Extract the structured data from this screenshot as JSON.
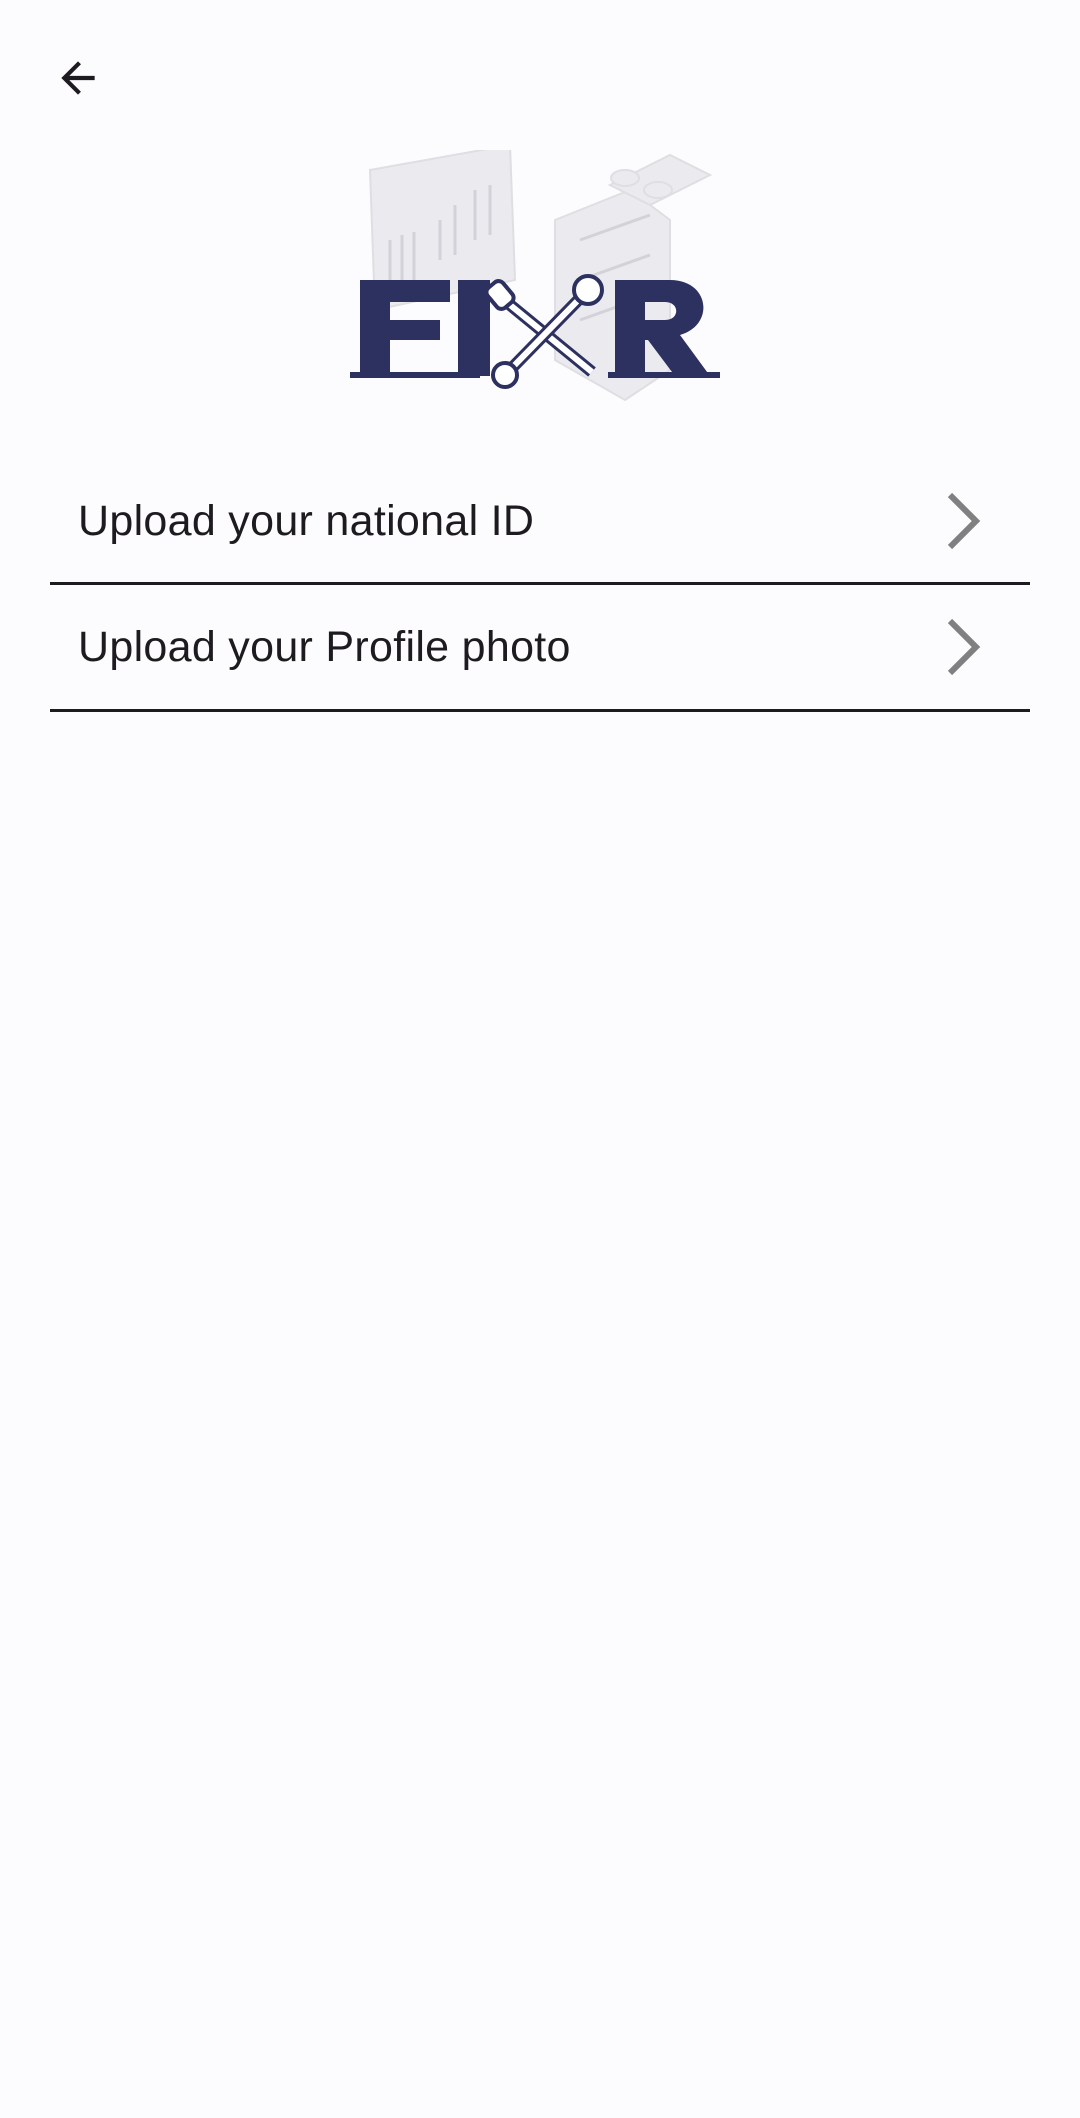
{
  "header": {
    "back_icon": "arrow-left-icon"
  },
  "logo": {
    "text": "FIXR",
    "brand_color": "#2d3160",
    "illustration_color": "#e6e6ea"
  },
  "upload_items": [
    {
      "label": "Upload your national ID",
      "icon": "chevron-right-icon"
    },
    {
      "label": "Upload your Profile photo",
      "icon": "chevron-right-icon"
    }
  ],
  "colors": {
    "background": "#fcfbfd",
    "text": "#1d1b20",
    "divider": "#1d1b20",
    "chevron": "#808080"
  }
}
